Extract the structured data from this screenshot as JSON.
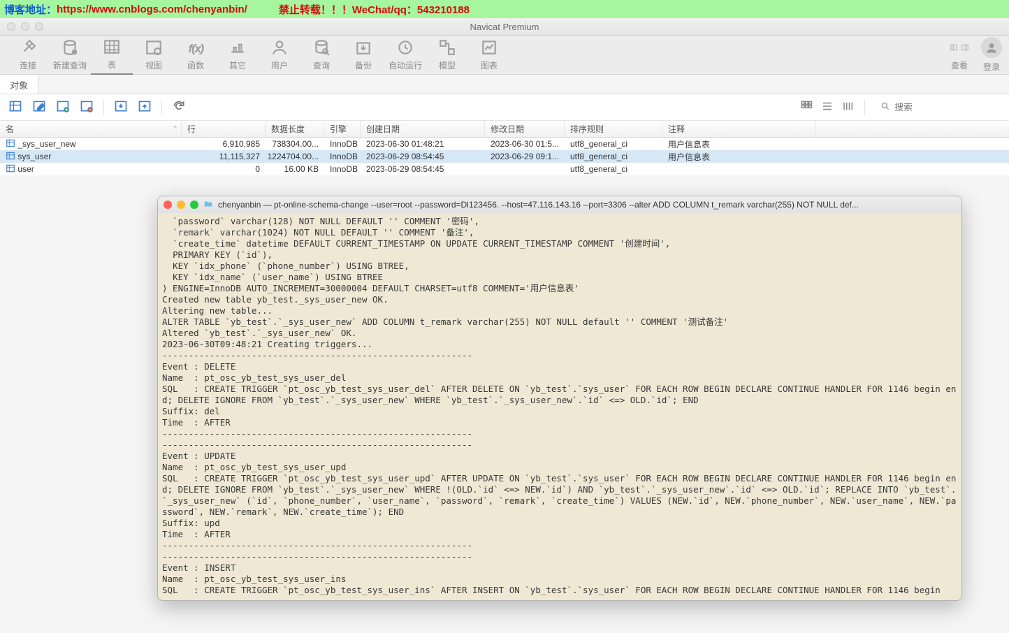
{
  "watermark": {
    "blog_label": "博客地址：",
    "blog_url": "https://www.cnblogs.com/chenyanbin/",
    "gap": "　　　",
    "warn": "禁止转载！！！WeChat/qq：543210188"
  },
  "window": {
    "title": "Navicat Premium"
  },
  "toolbar": {
    "items": [
      {
        "label": "连接"
      },
      {
        "label": "新建查询"
      },
      {
        "label": "表"
      },
      {
        "label": "视图"
      },
      {
        "label": "函数"
      },
      {
        "label": "其它"
      },
      {
        "label": "用户"
      },
      {
        "label": "查询"
      },
      {
        "label": "备份"
      },
      {
        "label": "自动运行"
      },
      {
        "label": "模型"
      },
      {
        "label": "图表"
      }
    ],
    "right": {
      "view": "查看",
      "login": "登录"
    }
  },
  "tabs": {
    "items": [
      {
        "label": "对象"
      }
    ]
  },
  "search": {
    "placeholder": "搜索"
  },
  "table": {
    "headers": {
      "name": "名",
      "rows": "行",
      "dlen": "数据长度",
      "engine": "引擎",
      "created": "创建日期",
      "modified": "修改日期",
      "collation": "排序规则",
      "comment": "注释"
    },
    "rows": [
      {
        "name": "_sys_user_new",
        "rows": "6,910,985",
        "dlen": "738304.00...",
        "engine": "InnoDB",
        "created": "2023-06-30 01:48:21",
        "modified": "2023-06-30 01:5...",
        "collation": "utf8_general_ci",
        "comment": "用户信息表"
      },
      {
        "name": "sys_user",
        "rows": "11,115,327",
        "dlen": "1224704.00...",
        "engine": "InnoDB",
        "created": "2023-06-29 08:54:45",
        "modified": "2023-06-29 09:1...",
        "collation": "utf8_general_ci",
        "comment": "用户信息表"
      },
      {
        "name": "user",
        "rows": "0",
        "dlen": "16.00 KB",
        "engine": "InnoDB",
        "created": "2023-06-29 08:54:45",
        "modified": "",
        "collation": "utf8_general_ci",
        "comment": ""
      }
    ]
  },
  "terminal": {
    "title": "chenyanbin — pt-online-schema-change --user=root --password=Dl123456. --host=47.116.143.16 --port=3306 --alter ADD COLUMN t_remark varchar(255) NOT NULL def...",
    "content": "  `password` varchar(128) NOT NULL DEFAULT '' COMMENT '密码',\n  `remark` varchar(1024) NOT NULL DEFAULT '' COMMENT '备注',\n  `create_time` datetime DEFAULT CURRENT_TIMESTAMP ON UPDATE CURRENT_TIMESTAMP COMMENT '创建时间',\n  PRIMARY KEY (`id`),\n  KEY `idx_phone` (`phone_number`) USING BTREE,\n  KEY `idx_name` (`user_name`) USING BTREE\n) ENGINE=InnoDB AUTO_INCREMENT=30000004 DEFAULT CHARSET=utf8 COMMENT='用户信息表'\nCreated new table yb_test._sys_user_new OK.\nAltering new table...\nALTER TABLE `yb_test`.`_sys_user_new` ADD COLUMN t_remark varchar(255) NOT NULL default '' COMMENT '测试备注'\nAltered `yb_test`.`_sys_user_new` OK.\n2023-06-30T09:48:21 Creating triggers...\n-----------------------------------------------------------\nEvent : DELETE\nName  : pt_osc_yb_test_sys_user_del\nSQL   : CREATE TRIGGER `pt_osc_yb_test_sys_user_del` AFTER DELETE ON `yb_test`.`sys_user` FOR EACH ROW BEGIN DECLARE CONTINUE HANDLER FOR 1146 begin end; DELETE IGNORE FROM `yb_test`.`_sys_user_new` WHERE `yb_test`.`_sys_user_new`.`id` <=> OLD.`id`; END\nSuffix: del\nTime  : AFTER\n-----------------------------------------------------------\n-----------------------------------------------------------\nEvent : UPDATE\nName  : pt_osc_yb_test_sys_user_upd\nSQL   : CREATE TRIGGER `pt_osc_yb_test_sys_user_upd` AFTER UPDATE ON `yb_test`.`sys_user` FOR EACH ROW BEGIN DECLARE CONTINUE HANDLER FOR 1146 begin end; DELETE IGNORE FROM `yb_test`.`_sys_user_new` WHERE !(OLD.`id` <=> NEW.`id`) AND `yb_test`.`_sys_user_new`.`id` <=> OLD.`id`; REPLACE INTO `yb_test`.`_sys_user_new` (`id`, `phone_number`, `user_name`, `password`, `remark`, `create_time`) VALUES (NEW.`id`, NEW.`phone_number`, NEW.`user_name`, NEW.`password`, NEW.`remark`, NEW.`create_time`); END\nSuffix: upd\nTime  : AFTER\n-----------------------------------------------------------\n-----------------------------------------------------------\nEvent : INSERT\nName  : pt_osc_yb_test_sys_user_ins\nSQL   : CREATE TRIGGER `pt_osc_yb_test_sys_user_ins` AFTER INSERT ON `yb_test`.`sys_user` FOR EACH ROW BEGIN DECLARE CONTINUE HANDLER FOR 1146 begin"
  }
}
